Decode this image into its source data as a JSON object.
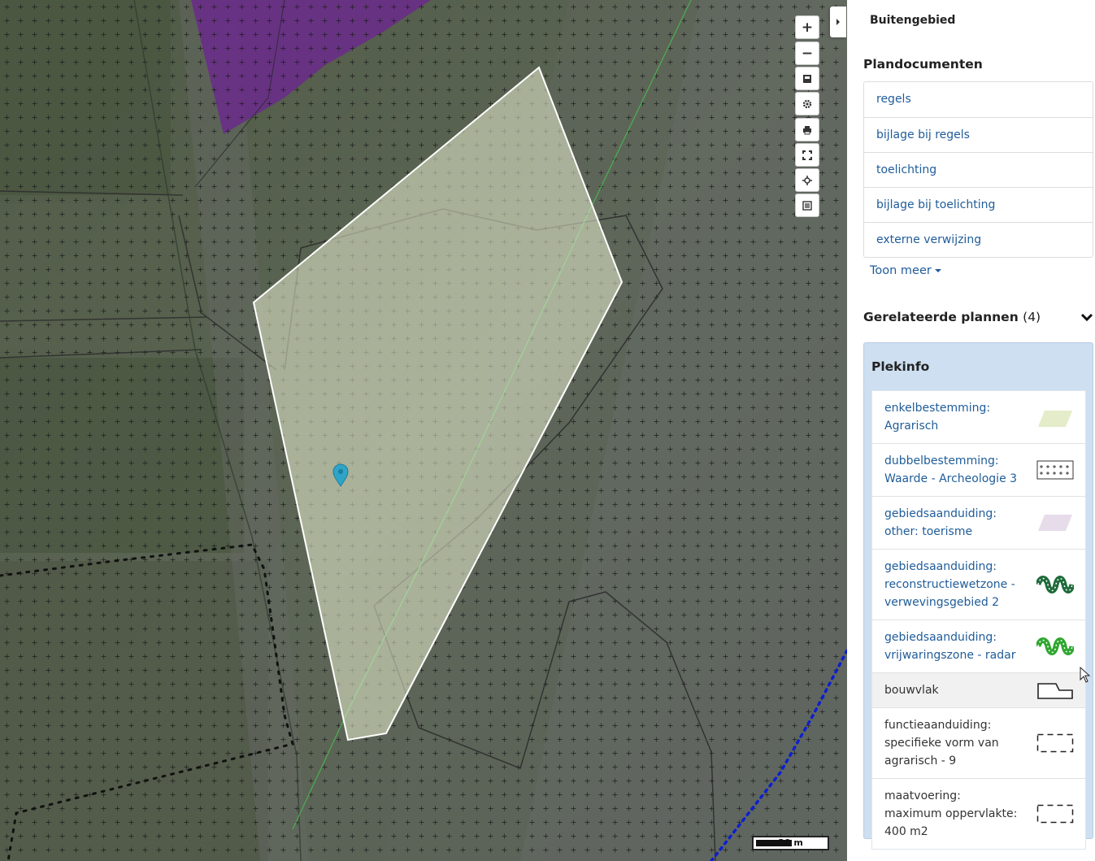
{
  "map": {
    "zoom_in_label": "+",
    "zoom_out_label": "−",
    "scale_label": "20 m",
    "controls": [
      "zoom-in",
      "zoom-out",
      "layers-icon",
      "settings-icon",
      "print-icon",
      "fullscreen-icon",
      "locate-icon",
      "legend-icon"
    ]
  },
  "sidebar": {
    "plan_title": "Buitengebied",
    "documents_heading": "Plandocumenten",
    "documents": [
      {
        "label": "regels"
      },
      {
        "label": "bijlage bij regels"
      },
      {
        "label": "toelichting"
      },
      {
        "label": "bijlage bij toelichting"
      },
      {
        "label": "externe verwijzing"
      }
    ],
    "show_more_label": "Toon meer",
    "related_plans_label": "Gerelateerde plannen",
    "related_plans_count": "(4)"
  },
  "plekinfo": {
    "title": "Plekinfo",
    "items": [
      {
        "line1": "enkelbestemming: Agrarisch",
        "line2": "",
        "line3": "",
        "symbol": "pale-green-parallelogram"
      },
      {
        "line1": "dubbelbestemming:",
        "line2": "Waarde - Archeologie 3",
        "line3": "",
        "symbol": "cross-hatch-box"
      },
      {
        "line1": "gebiedsaanduiding:",
        "line2": "other: toerisme",
        "line3": "",
        "symbol": "pale-purple-parallelogram"
      },
      {
        "line1": "gebiedsaanduiding:",
        "line2": "reconstructiewetzone -",
        "line3": "verwevingsgebied 2",
        "symbol": "dark-green-zigzag"
      },
      {
        "line1": "gebiedsaanduiding:",
        "line2": "vrijwaringszone - radar",
        "line3": "",
        "symbol": "bright-green-zigzag"
      },
      {
        "line1": "bouwvlak",
        "line2": "",
        "line3": "",
        "symbol": "building-outline"
      },
      {
        "line1": "functieaanduiding:",
        "line2": "specifieke vorm van",
        "line3": "agrarisch - 9",
        "symbol": "dashed-box"
      },
      {
        "line1": "maatvoering:",
        "line2": "maximum oppervlakte:",
        "line3": "400 m2",
        "symbol": "dashed-box"
      }
    ]
  },
  "colors": {
    "link": "#1f5c99",
    "plekinfo_bg": "#cddff0",
    "selection_fill": "#e9f0d2",
    "purple_zone": "#6b2a8c"
  }
}
